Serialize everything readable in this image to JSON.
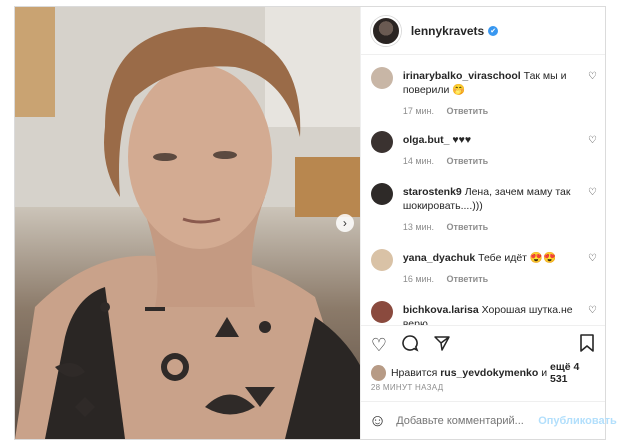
{
  "post": {
    "username": "lennykravets",
    "verified_mark": "✔",
    "image_next_arrow": "›"
  },
  "comments": [
    {
      "user": "irinarybalko_viraschool",
      "text": "Так мы и поверили 🤭",
      "time": "17 мин.",
      "reply": "Ответить"
    },
    {
      "user": "olga.but_",
      "text": "♥♥♥",
      "time": "14 мин.",
      "reply": "Ответить"
    },
    {
      "user": "starostenk9",
      "text": "Лена, зачем маму так шокировать....)))",
      "time": "13 мин.",
      "reply": "Ответить"
    },
    {
      "user": "yana_dyachuk",
      "text": "Тебе идёт 😍😍",
      "time": "16 мин.",
      "reply": "Ответить"
    },
    {
      "user": "bichkova.larisa",
      "text": "Хорошая шутка.не верю",
      "time": "",
      "reply": ""
    }
  ],
  "actions": {
    "like_icon": "heart-outline-icon",
    "comment_icon": "comment-bubble-icon",
    "share_icon": "paper-plane-icon",
    "save_icon": "bookmark-icon"
  },
  "likes": {
    "prefix": "Нравится",
    "user": "rus_yevdokymenko",
    "suffix": "и",
    "count": "ещё 4 531"
  },
  "timestamp": "28 МИНУТ НАЗАД",
  "add_comment": {
    "placeholder": "Добавьте комментарий...",
    "publish_label": "Опубликовать"
  },
  "colors": {
    "border": "#dbdbdb",
    "muted": "#8e8e8e",
    "verified": "#3897f0",
    "publish_disabled": "#b2dffc"
  }
}
